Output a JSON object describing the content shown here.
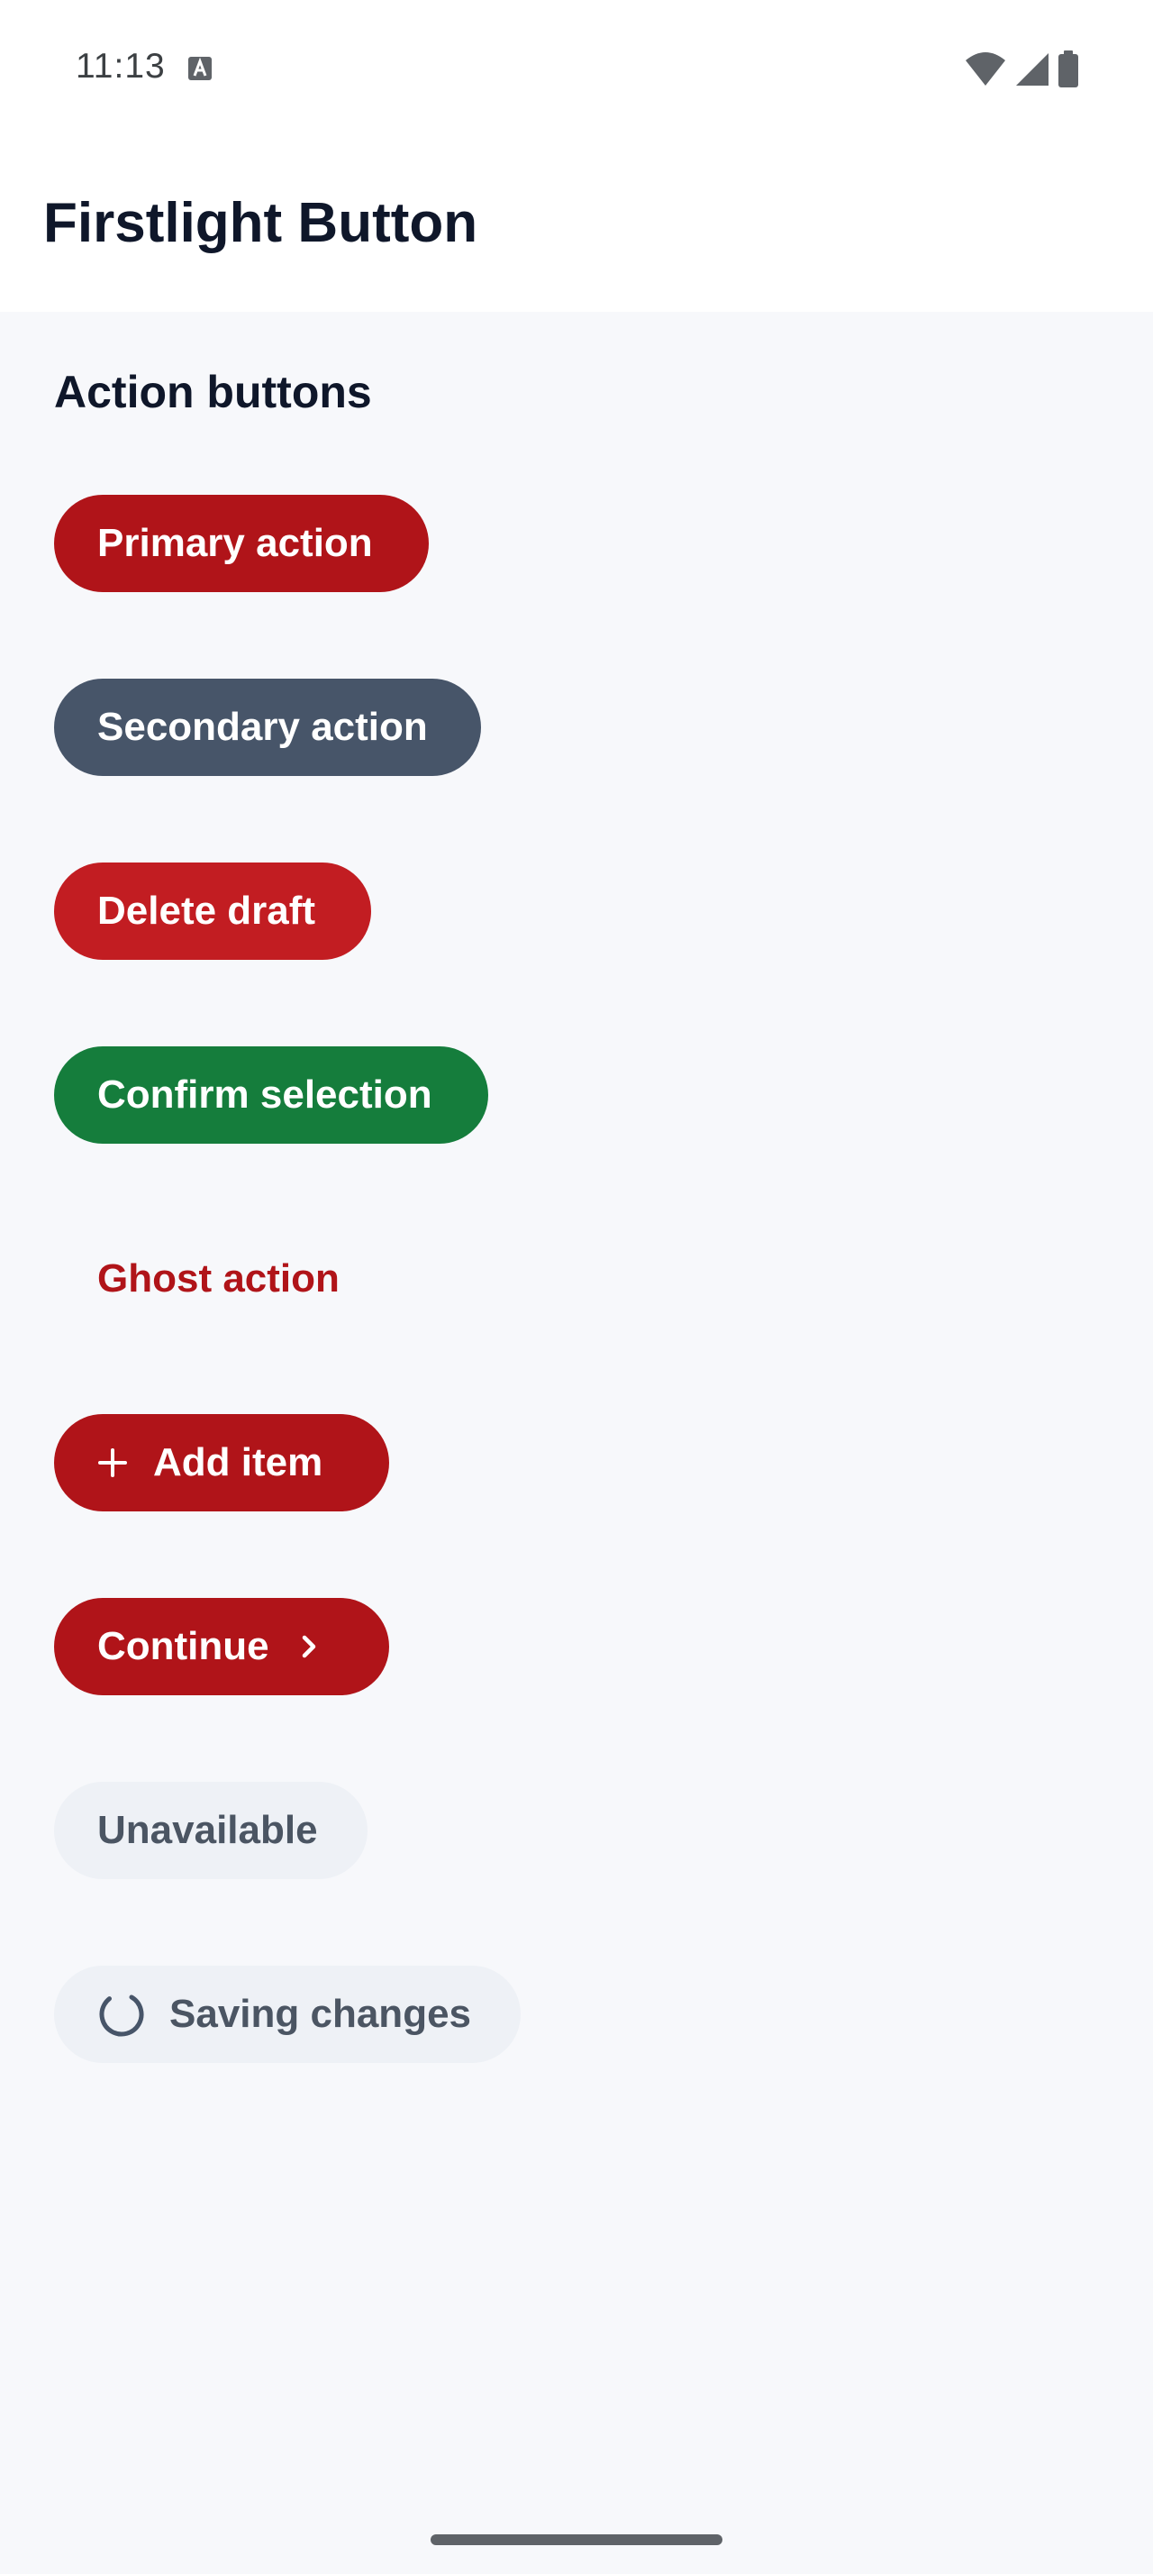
{
  "status_bar": {
    "time": "11:13",
    "icons": [
      "text-a-icon",
      "wifi-icon",
      "cellular-signal-icon",
      "battery-icon"
    ]
  },
  "app_bar": {
    "title": "Firstlight Button"
  },
  "section": {
    "heading": "Action buttons"
  },
  "buttons": {
    "primary": "Primary action",
    "secondary": "Secondary action",
    "delete": "Delete draft",
    "confirm": "Confirm selection",
    "ghost": "Ghost action",
    "add": "Add item",
    "continue": "Continue",
    "unavailable": "Unavailable",
    "saving": "Saving changes"
  },
  "icons": {
    "add": "plus-icon",
    "continue": "chevron-right-icon",
    "saving": "loading-spinner-icon"
  },
  "colors": {
    "primary": "#b01419",
    "secondary": "#475569",
    "danger": "#c21d22",
    "success": "#157d3c",
    "disabled_bg": "#eef1f6",
    "disabled_text": "#4b5563",
    "title_text": "#0f172a"
  }
}
